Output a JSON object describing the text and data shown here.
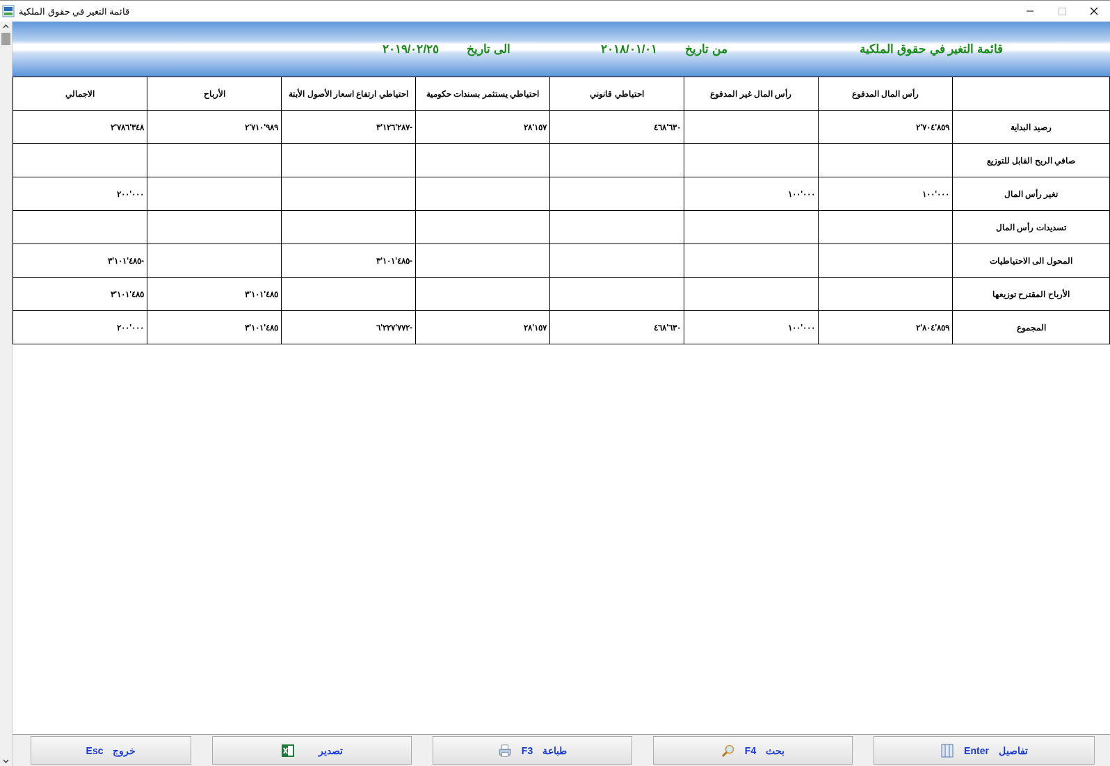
{
  "window": {
    "title": "قائمة التغير في حقوق الملكية"
  },
  "header": {
    "title": "قائمة التغير في حقوق الملكية",
    "from_label": "من تاريخ",
    "from_date": "٢٠١٨/٠١/٠١",
    "to_label": "الى تاريخ",
    "to_date": "٢٠١٩/٠٢/٢٥"
  },
  "table": {
    "columns": [
      "رأس المال المدفوع",
      "رأس المال غير المدفوع",
      "احتياطي قانوني",
      "احتياطي يستثمر بسندات حكومية",
      "احتياطي ارتفاع اسعار الأصول الأبتة",
      "الأرباح",
      "الاجمالي"
    ],
    "rows": [
      {
        "label": "رصيد البداية",
        "cells": [
          "٢'٧٠٤'٨٥٩",
          null,
          "٤٦٨'٦٣٠",
          "٢٨'١٥٧",
          "٣'١٢٦'٢٨٧-",
          "٢'٧١٠'٩٨٩",
          "٢'٧٨٦'٣٤٨"
        ]
      },
      {
        "label": "صافي الربح القابل للتوزيع",
        "cells": [
          null,
          null,
          null,
          null,
          null,
          null,
          null
        ]
      },
      {
        "label": "تغير رأس المال",
        "cells": [
          "١٠٠'٠٠٠",
          "١٠٠'٠٠٠",
          null,
          null,
          null,
          null,
          "٢٠٠'٠٠٠"
        ]
      },
      {
        "label": "تسديدات رأس المال",
        "cells": [
          null,
          null,
          null,
          null,
          null,
          null,
          null
        ]
      },
      {
        "label": "المحول الى الاحتياطيات",
        "cells": [
          null,
          null,
          null,
          null,
          "٣'١٠١'٤٨٥-",
          null,
          "٣'١٠١'٤٨٥-"
        ]
      },
      {
        "label": "الأرباح المقترح توزيعها",
        "cells": [
          null,
          null,
          null,
          null,
          null,
          "٣'١٠١'٤٨٥",
          "٣'١٠١'٤٨٥"
        ]
      },
      {
        "label": "المجموع",
        "cells": [
          "٢'٨٠٤'٨٥٩",
          "١٠٠'٠٠٠",
          "٤٦٨'٦٣٠",
          "٢٨'١٥٧",
          "٦'٢٢٧'٧٧٢-",
          "٣'١٠١'٤٨٥",
          "٢٠٠'٠٠٠"
        ]
      }
    ]
  },
  "buttons": [
    {
      "kind": "details",
      "label": "تفاصيل",
      "key": "Enter"
    },
    {
      "kind": "search",
      "label": "بحث",
      "key": "F4"
    },
    {
      "kind": "print",
      "label": "طباعة",
      "key": "F3"
    },
    {
      "kind": "export",
      "label": "تصدير"
    },
    {
      "kind": "exit",
      "label": "خروج",
      "key": "Esc"
    }
  ]
}
